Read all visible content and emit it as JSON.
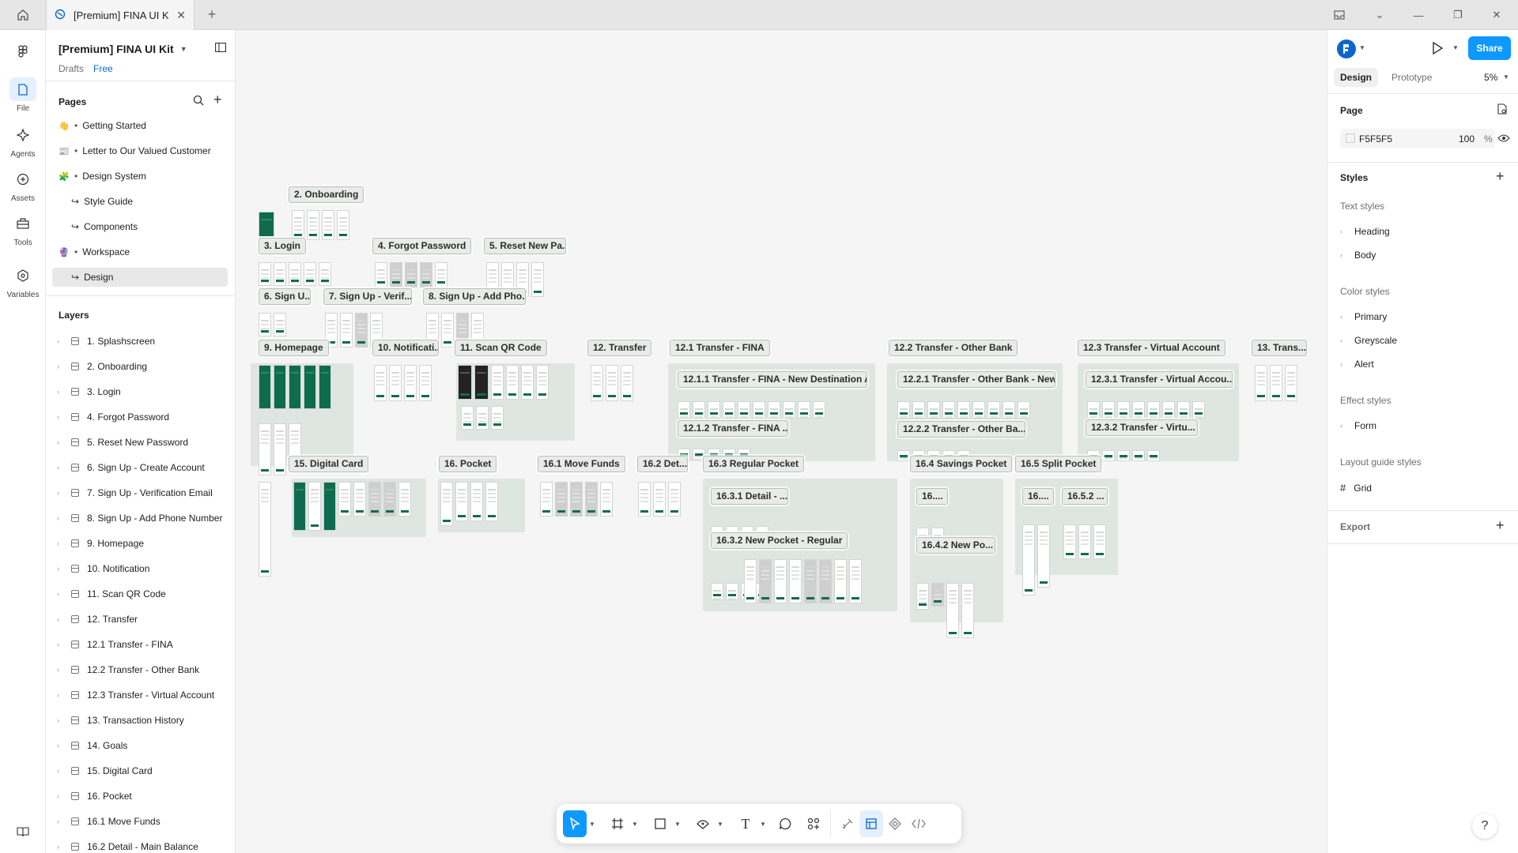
{
  "titlebar": {
    "tab_title": "[Premium] FINA UI Kit"
  },
  "rail": {
    "items": [
      {
        "label": "File"
      },
      {
        "label": "Agents"
      },
      {
        "label": "Assets"
      },
      {
        "label": "Tools"
      },
      {
        "label": "Variables"
      }
    ]
  },
  "file": {
    "title": "[Premium] FINA UI Kit",
    "location": "Drafts",
    "plan": "Free"
  },
  "pages": {
    "heading": "Pages",
    "items": [
      {
        "label": "Getting Started",
        "emoji": "👋"
      },
      {
        "label": "Letter to Our Valued Customer",
        "emoji": "📰"
      },
      {
        "label": "Design System",
        "emoji": "🧩"
      },
      {
        "label": "Style Guide",
        "sub": true
      },
      {
        "label": "Components",
        "sub": true
      },
      {
        "label": "Workspace",
        "emoji": "🔮"
      },
      {
        "label": "Design",
        "sub": true,
        "selected": true
      }
    ]
  },
  "layers": {
    "heading": "Layers",
    "items": [
      "1. Splashscreen",
      "2. Onboarding",
      "3. Login",
      "4. Forgot Password",
      "5. Reset New Password",
      "6. Sign Up - Create Account",
      "7. Sign Up - Verification Email",
      "8. Sign Up - Add Phone Number",
      "9. Homepage",
      "10. Notification",
      "11. Scan QR Code",
      "12. Transfer",
      "12.1 Transfer - FINA",
      "12.2 Transfer - Other Bank",
      "12.3 Transfer - Virtual Account",
      "13. Transaction History",
      "14. Goals",
      "15. Digital Card",
      "16. Pocket",
      "16.1 Move Funds",
      "16.2 Detail - Main Balance"
    ]
  },
  "right": {
    "share_label": "Share",
    "tabs": {
      "design": "Design",
      "prototype": "Prototype"
    },
    "zoom": "5%",
    "page": {
      "heading": "Page",
      "color": "F5F5F5",
      "opacity": "100",
      "percent": "%"
    },
    "styles": {
      "heading": "Styles",
      "text_styles": {
        "heading": "Text styles",
        "items": [
          "Heading",
          "Body"
        ]
      },
      "color_styles": {
        "heading": "Color styles",
        "items": [
          "Primary",
          "Greyscale",
          "Alert"
        ]
      },
      "effect_styles": {
        "heading": "Effect styles",
        "items": [
          "Form"
        ]
      },
      "layout_styles": {
        "heading": "Layout guide styles",
        "items": [
          "Grid"
        ]
      }
    },
    "export": "Export"
  },
  "canvas": {
    "frames": [
      "2. Onboarding",
      "3. Login",
      "4. Forgot Password",
      "5. Reset New Pa...",
      "6. Sign U...",
      "7. Sign Up - Verif...",
      "8. Sign Up - Add Pho...",
      "9. Homepage",
      "10. Notificati...",
      "11. Scan QR Code",
      "12. Transfer",
      "12.1 Transfer - FINA",
      "12.2 Transfer - Other Bank",
      "12.3 Transfer - Virtual Account",
      "13. Trans...",
      "12.1.1 Transfer - FINA - New Destination A...",
      "12.1.2 Transfer - FINA ...",
      "12.2.1 Transfer - Other Bank - New...",
      "12.2.2 Transfer - Other Ba...",
      "12.3.1 Transfer - Virtual Accou...",
      "12.3.2 Transfer - Virtu...",
      "15. Digital Card",
      "16. Pocket",
      "16.1 Move Funds",
      "16.2 Det...",
      "16.3 Regular Pocket",
      "16.4 Savings Pocket",
      "16.5 Split Pocket",
      "16.3.1 Detail - ...",
      "16.3.2 New Pocket - Regular",
      "16....",
      "16.4.2 New Po...",
      "16....",
      "16.5.2 ..."
    ]
  },
  "colors": {
    "accent": "#0d99ff",
    "brand_green": "#0f6b4d",
    "canvas": "#F5F5F5"
  }
}
